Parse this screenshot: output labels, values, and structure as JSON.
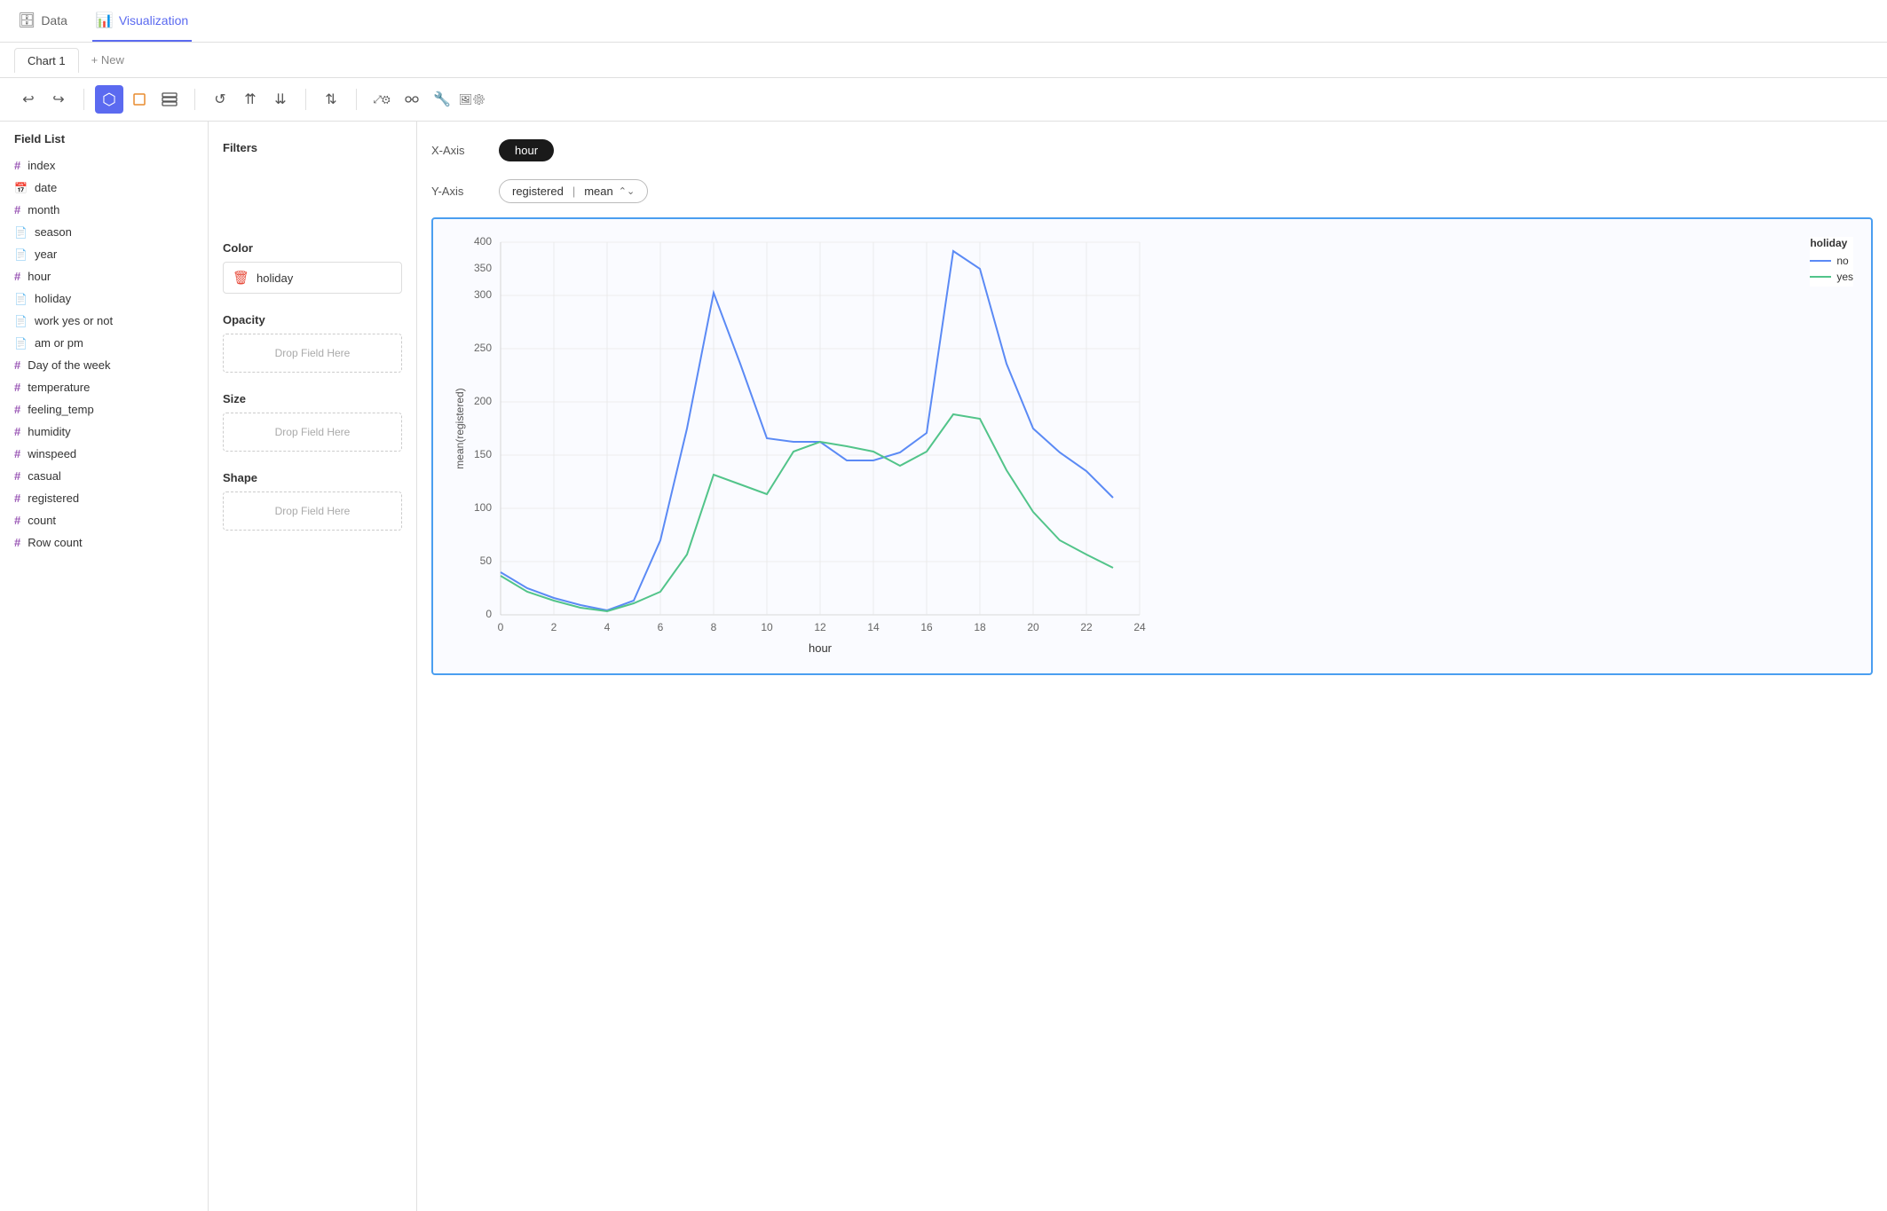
{
  "nav": {
    "data_label": "Data",
    "visualization_label": "Visualization",
    "data_icon": "🗄",
    "vis_icon": "📊"
  },
  "tabs": {
    "chart1_label": "Chart 1",
    "new_label": "+ New"
  },
  "toolbar": {
    "undo_label": "↩",
    "redo_label": "↪",
    "chart_icon_label": "⬡",
    "filter_icon_label": "□",
    "layers_icon_label": "⧉",
    "refresh_label": "↺",
    "sort_asc_label": "⇈",
    "sort_desc_label": "⇊",
    "up_down_label": "⇅",
    "expand_label": "⤢",
    "settings1_label": "⚙",
    "connect_label": "⇄",
    "wrench_label": "🔧",
    "image_label": "🖼",
    "settings2_label": "⚙"
  },
  "field_list": {
    "title": "Field List",
    "fields": [
      {
        "name": "index",
        "type": "hash"
      },
      {
        "name": "date",
        "type": "date"
      },
      {
        "name": "month",
        "type": "hash"
      },
      {
        "name": "season",
        "type": "cat"
      },
      {
        "name": "year",
        "type": "cat"
      },
      {
        "name": "hour",
        "type": "hash"
      },
      {
        "name": "holiday",
        "type": "cat"
      },
      {
        "name": "work yes or not",
        "type": "cat"
      },
      {
        "name": "am or pm",
        "type": "cat"
      },
      {
        "name": "Day of the week",
        "type": "hash"
      },
      {
        "name": "temperature",
        "type": "hash"
      },
      {
        "name": "feeling_temp",
        "type": "hash"
      },
      {
        "name": "humidity",
        "type": "hash"
      },
      {
        "name": "winspeed",
        "type": "hash"
      },
      {
        "name": "casual",
        "type": "hash"
      },
      {
        "name": "registered",
        "type": "hash"
      },
      {
        "name": "count",
        "type": "hash"
      },
      {
        "name": "Row count",
        "type": "hash"
      }
    ]
  },
  "filters": {
    "title": "Filters",
    "color_title": "Color",
    "color_field": "holiday",
    "opacity_title": "Opacity",
    "opacity_placeholder": "Drop Field Here",
    "size_title": "Size",
    "size_placeholder": "Drop Field Here",
    "shape_title": "Shape",
    "shape_placeholder": "Drop Field Here"
  },
  "chart": {
    "xaxis_label": "X-Axis",
    "yaxis_label": "Y-Axis",
    "xaxis_field": "hour",
    "yaxis_field": "registered",
    "yaxis_agg": "mean",
    "y_axis_title": "mean(registered)",
    "x_axis_title": "hour",
    "legend_title": "holiday",
    "legend_no": "no",
    "legend_yes": "yes",
    "color_no": "#5b8af5",
    "color_yes": "#52c48a"
  }
}
